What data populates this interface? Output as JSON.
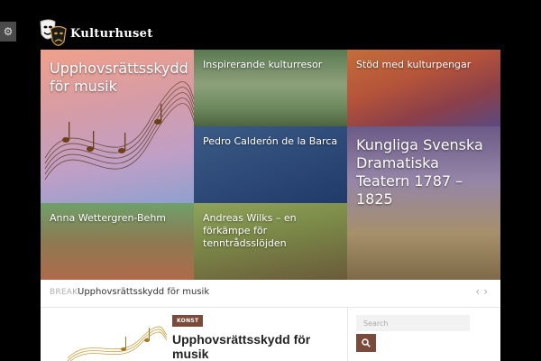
{
  "site": {
    "name": "Kulturhuset"
  },
  "settings_tab": {
    "icon": "gear-icon"
  },
  "featured": [
    {
      "title": "Upphovsrättsskydd för musik"
    },
    {
      "title": "Inspirerande kulturresor"
    },
    {
      "title": "Stöd med kulturpengar"
    },
    {
      "title": "Pedro Calderón de la Barca"
    },
    {
      "title": "Kungliga Svenska Dramatiska Teatern 1787 – 1825"
    },
    {
      "title": "Anna Wettergren-Behm"
    },
    {
      "title": "Andreas Wilks – en förkämpe för tenntrådsslöjden"
    }
  ],
  "breaking": {
    "label": "Breaking",
    "headline": "Upphovsrättsskydd för musik",
    "prev_icon": "chevron-left-icon",
    "next_icon": "chevron-right-icon"
  },
  "post": {
    "category": "KONST",
    "title": "Upphovsrättsskydd för musik"
  },
  "search": {
    "placeholder": "Search",
    "button_icon": "search-icon"
  },
  "colors": {
    "accent": "#7a4a3a"
  }
}
